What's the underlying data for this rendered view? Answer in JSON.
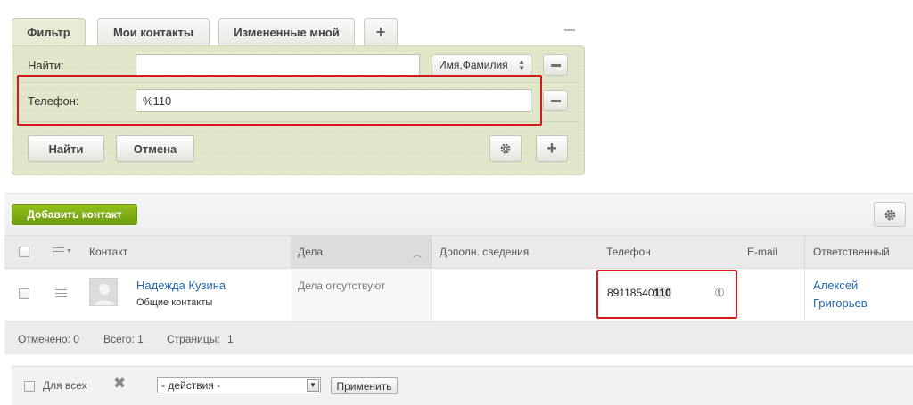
{
  "filter": {
    "tabs": [
      {
        "label": "Фильтр",
        "active": true
      },
      {
        "label": "Мои контакты",
        "active": false
      },
      {
        "label": "Измененные мной",
        "active": false
      }
    ],
    "add_tab_symbol": "+",
    "find_label": "Найти:",
    "find_value": "",
    "find_scope": "Имя,Фамилия",
    "phone_label": "Телефон:",
    "phone_value": "%110",
    "find_button": "Найти",
    "cancel_button": "Отмена",
    "add_field_symbol": "+"
  },
  "grid": {
    "add_contact_button": "Добавить контакт",
    "columns": {
      "contact": "Контакт",
      "deals": "Дела",
      "additional": "Дополн. сведения",
      "phone": "Телефон",
      "email": "E-mail",
      "responsible": "Ответственный"
    },
    "rows": [
      {
        "name": "Надежда Кузина",
        "type": "Общие контакты",
        "deals": "Дела отсутствуют",
        "phone_prefix": "89118540",
        "phone_match": "110",
        "responsible_first": "Алексей",
        "responsible_last": "Григорьев"
      }
    ],
    "footer": {
      "selected": "Отмечено: 0",
      "total": "Всего: 1",
      "pages": "Страницы:",
      "page_number": "1"
    }
  },
  "actions": {
    "for_all_label": "Для всех",
    "select_value": "- действия -",
    "apply_button": "Применить"
  },
  "colors": {
    "accent_green": "#7aa712",
    "highlight_red": "#d7191c",
    "link_blue": "#2067b0",
    "filter_bg": "#e2e8cb"
  }
}
